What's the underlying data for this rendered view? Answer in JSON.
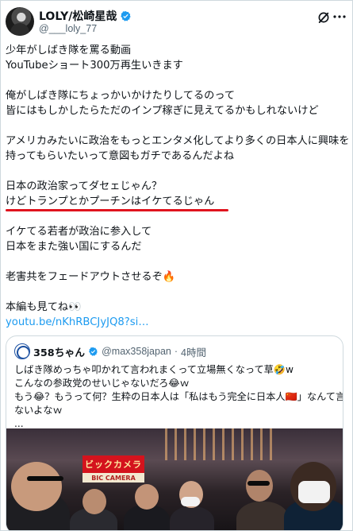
{
  "author": {
    "display_name": "LOLY/松崎星哉",
    "handle": "@___loly_77",
    "verified": true,
    "avatar_icon": "avatar-image"
  },
  "actions": {
    "grok_icon": "grok-icon",
    "more_icon": "more-icon"
  },
  "body": {
    "lines": [
      "少年がしばき隊を罵る動画",
      "YouTubeショート300万再生いきます",
      "",
      "俺がしばき隊にちょっかいかけたりしてるのって",
      "皆にはもしかしたらただのインプ稼ぎに見えてるかもしれないけど",
      "",
      "アメリカみたいに政治をもっとエンタメ化してより多くの日本人に興味を",
      "持ってもらいたいって意図もガチであるんだよね",
      "",
      "日本の政治家ってダセェじゃん？",
      "けどトランプとかプーチンはイケてるじゃん",
      "",
      "イケてる若者が政治に参入して",
      "日本をまた強い国にするんだ",
      "",
      "老害共をフェードアウトさせるぞ🔥",
      "",
      "本編も見てね👀",
      "youtu.be/nKhRBCJyJQ8?si…"
    ],
    "highlight_color": "#e0141e"
  },
  "quote": {
    "display_name": "358ちゃん",
    "verified": true,
    "handle": "@max358japan",
    "separator": "·",
    "time": "4時間",
    "lines": [
      "しばき隊めっちゃ叩かれて言われまくって立場無くなって草🤣w",
      "こんなの参政党のせいじゃないだろ😂ｗ",
      "もう😂？もうって何？生粋の日本人は「私はもう完全に日本人🇨🇳」なんて言わ",
      "ないよなｗ",
      "..."
    ],
    "media": {
      "sign_text": "ビックカメラ",
      "sign_sub": "BIC CAMERA"
    }
  },
  "colors": {
    "link": "#1d9bf0",
    "verified": "#1d9bf0",
    "secondary_text": "#536471",
    "border": "#cfd9de"
  }
}
